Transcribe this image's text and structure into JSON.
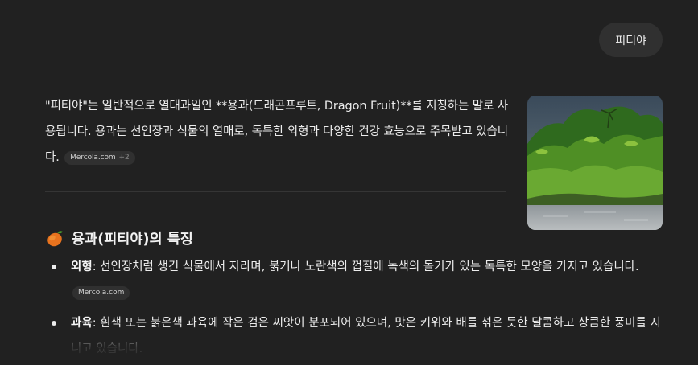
{
  "user_message": "피티야",
  "answer": {
    "intro": "\"피티야\"는 일반적으로 열대과일인 **용과(드래곤프루트, Dragon Fruit)**를 지칭하는 말로 사용됩니다. 용과는 선인장과 식물의 열매로, 독특한 외형과 다양한 건강 효능으로 주목받고 있습니다.",
    "intro_source": {
      "label": "Mercola.com",
      "more": "+2"
    }
  },
  "section": {
    "title": "용과(피티야)의 특징",
    "bullets": [
      {
        "term": "외형",
        "text": ": 선인장처럼 생긴 식물에서 자라며, 붉거나 노란색의 껍질에 녹색의 돌기가 있는 독특한 모양을 가지고 있습니다.",
        "source": "Mercola.com"
      },
      {
        "term": "과육",
        "text": ": 흰색 또는 붉은색 과육에 작은 검은 씨앗이 분포되어 있으며, 맛은 키위와 배를 섞은 듯한 달콤하고 상큼한 풍미를 지니고 있습니다."
      }
    ]
  },
  "icons": {
    "section_emoji": "mango-icon"
  },
  "colors": {
    "background": "#212121",
    "bubble": "#303030",
    "text": "#ececec"
  }
}
